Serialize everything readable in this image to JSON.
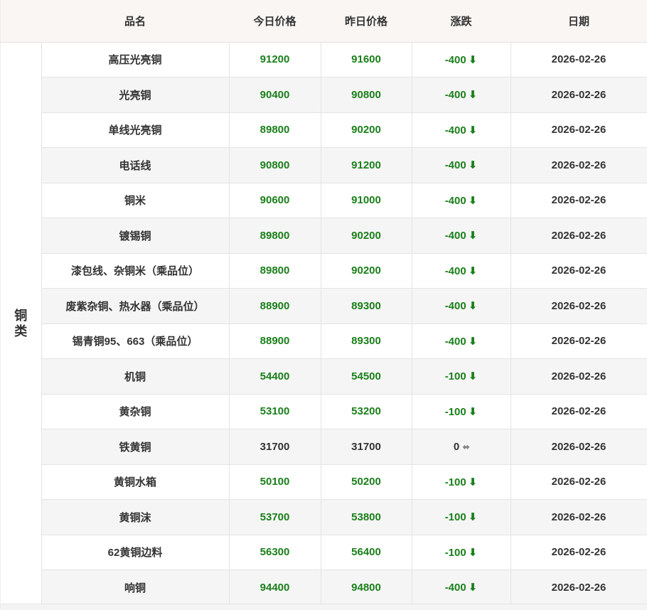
{
  "table": {
    "headers": [
      "品名",
      "今日价格",
      "昨日价格",
      "涨跌",
      "日期"
    ],
    "category": "铜类",
    "rows": [
      {
        "name": "高压光亮铜",
        "today": "91200",
        "yesterday": "91600",
        "change": "-400",
        "trend": "down",
        "date": "2026-02-26"
      },
      {
        "name": "光亮铜",
        "today": "90400",
        "yesterday": "90800",
        "change": "-400",
        "trend": "down",
        "date": "2026-02-26"
      },
      {
        "name": "单线光亮铜",
        "today": "89800",
        "yesterday": "90200",
        "change": "-400",
        "trend": "down",
        "date": "2026-02-26"
      },
      {
        "name": "电话线",
        "today": "90800",
        "yesterday": "91200",
        "change": "-400",
        "trend": "down",
        "date": "2026-02-26"
      },
      {
        "name": "铜米",
        "today": "90600",
        "yesterday": "91000",
        "change": "-400",
        "trend": "down",
        "date": "2026-02-26"
      },
      {
        "name": "镀锡铜",
        "today": "89800",
        "yesterday": "90200",
        "change": "-400",
        "trend": "down",
        "date": "2026-02-26"
      },
      {
        "name": "漆包线、杂铜米（乘品位）",
        "today": "89800",
        "yesterday": "90200",
        "change": "-400",
        "trend": "down",
        "date": "2026-02-26"
      },
      {
        "name": "废紫杂铜、热水器（乘品位）",
        "today": "88900",
        "yesterday": "89300",
        "change": "-400",
        "trend": "down",
        "date": "2026-02-26"
      },
      {
        "name": "锡青铜95、663（乘品位）",
        "today": "88900",
        "yesterday": "89300",
        "change": "-400",
        "trend": "down",
        "date": "2026-02-26"
      },
      {
        "name": "机铜",
        "today": "54400",
        "yesterday": "54500",
        "change": "-100",
        "trend": "down",
        "date": "2026-02-26"
      },
      {
        "name": "黄杂铜",
        "today": "53100",
        "yesterday": "53200",
        "change": "-100",
        "trend": "down",
        "date": "2026-02-26"
      },
      {
        "name": "铁黄铜",
        "today": "31700",
        "yesterday": "31700",
        "change": "0",
        "trend": "flat",
        "date": "2026-02-26"
      },
      {
        "name": "黄铜水箱",
        "today": "50100",
        "yesterday": "50200",
        "change": "-100",
        "trend": "down",
        "date": "2026-02-26"
      },
      {
        "name": "黄铜沫",
        "today": "53700",
        "yesterday": "53800",
        "change": "-100",
        "trend": "down",
        "date": "2026-02-26"
      },
      {
        "name": "62黄铜边料",
        "today": "56300",
        "yesterday": "56400",
        "change": "-100",
        "trend": "down",
        "date": "2026-02-26"
      },
      {
        "name": "响铜",
        "today": "94400",
        "yesterday": "94800",
        "change": "-400",
        "trend": "down",
        "date": "2026-02-26"
      }
    ]
  },
  "icons": {
    "down": "arrow-down-icon",
    "flat": "arrow-left-right-icon"
  },
  "colors": {
    "down": "#1a7f1a",
    "header_bg": "#f9f6f4",
    "stripe_bg": "#f5f5f5"
  }
}
